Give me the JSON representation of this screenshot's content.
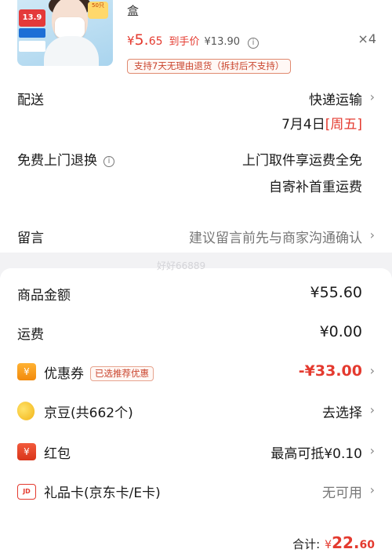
{
  "product": {
    "title_fragment": "盒",
    "thumb_price_tag": "13.9",
    "thumb_sticker": "50只",
    "price_currency": "¥",
    "price_int": "5.",
    "price_dec": "65",
    "price_hand_label": "到手价",
    "original_price": "¥13.90",
    "quantity": "×4",
    "return_policy": "支持7天无理由退货（拆封后不支持）"
  },
  "delivery": {
    "label": "配送",
    "method": "快递运输",
    "date": "7月4日",
    "weekday": "[周五]"
  },
  "free_return": {
    "label": "免费上门退换",
    "line1": "上门取件享运费全免",
    "line2": "自寄补首重运费"
  },
  "message": {
    "label": "留言",
    "placeholder": "建议留言前先与商家沟通确认"
  },
  "watermark": "好好66889",
  "summary": {
    "goods_label": "商品金额",
    "goods_value": "¥55.60",
    "shipping_label": "运费",
    "shipping_value": "¥0.00",
    "coupon_label": "优惠券",
    "coupon_badge": "已选推荐优惠",
    "coupon_value": "-¥33.00",
    "beans_label": "京豆(共662个)",
    "beans_value": "去选择",
    "redpacket_label": "红包",
    "redpacket_value": "最高可抵¥0.10",
    "giftcard_label": "礼品卡(京东卡/E卡)",
    "giftcard_value": "无可用"
  },
  "icons": {
    "coupon": "¥",
    "redpacket": "¥",
    "giftcard": "JD"
  },
  "total": {
    "label": "合计:",
    "currency": "¥",
    "int": "22.",
    "dec": "60"
  },
  "colors": {
    "accent_red": "#e43a2f",
    "background": "#f2f2f4"
  }
}
